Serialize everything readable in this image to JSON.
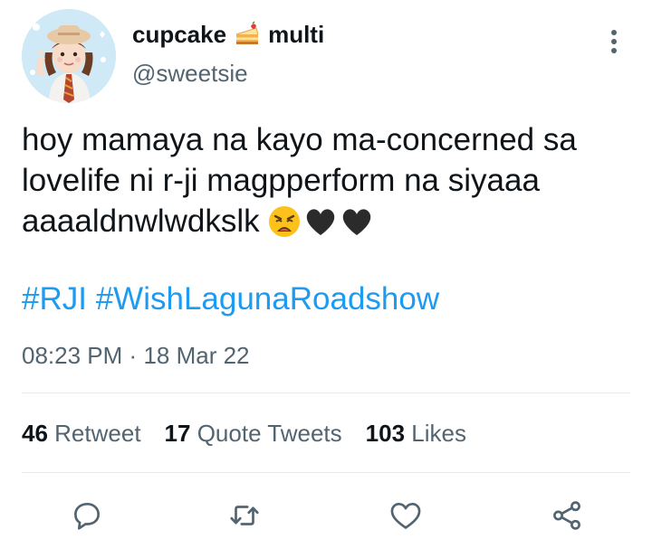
{
  "author": {
    "display_name": "cupcake",
    "display_name_suffix": "multi",
    "name_icon": "cake-slice-icon",
    "handle": "@sweetsie",
    "avatar_icon": "profile-avatar"
  },
  "tweet": {
    "lines": [
      "hoy mamaya na kayo ma-concerned sa",
      "lovelife ni r-ji magpperform na siyaaa",
      "aaaaldnwlwdkslk"
    ],
    "emojis": [
      "weary-face-emoji",
      "black-heart-emoji",
      "black-heart-emoji"
    ],
    "hashtags": [
      "#RJI",
      "#WishLagunaRoadshow"
    ]
  },
  "timestamp": {
    "time": "08:23 PM",
    "separator": "·",
    "date": "18 Mar 22"
  },
  "stats": {
    "retweets": {
      "count": "46",
      "label": "Retweet"
    },
    "quotes": {
      "count": "17",
      "label": "Quote Tweets"
    },
    "likes": {
      "count": "103",
      "label": "Likes"
    }
  },
  "actions": {
    "reply": "reply-icon",
    "retweet": "retweet-icon",
    "like": "like-icon",
    "share": "share-icon"
  },
  "colors": {
    "text_primary": "#0f1419",
    "text_secondary": "#536471",
    "link": "#1d9bf0",
    "divider": "#e6ecf0",
    "icon": "#536471"
  }
}
